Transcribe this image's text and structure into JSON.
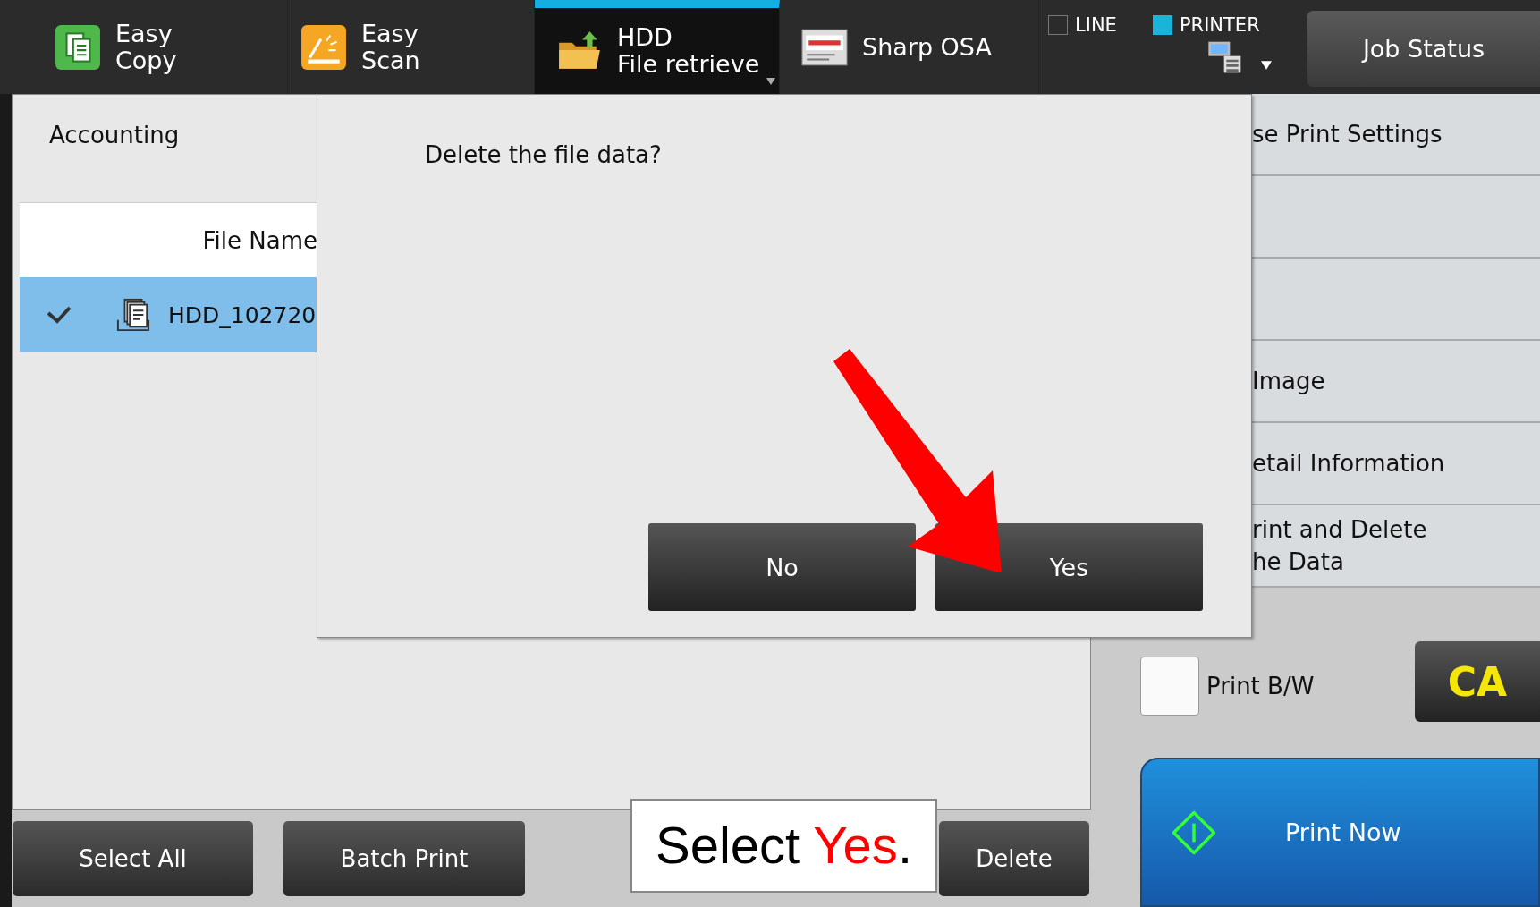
{
  "tabs": [
    {
      "kind": "copy",
      "lines": [
        "Easy",
        "Copy"
      ],
      "selected": false
    },
    {
      "kind": "scan",
      "lines": [
        "Easy",
        "Scan"
      ],
      "selected": false
    },
    {
      "kind": "folder",
      "lines": [
        "HDD",
        "File retrieve"
      ],
      "selected": true
    },
    {
      "kind": "osa",
      "lines": [
        "Sharp OSA"
      ],
      "selected": false
    }
  ],
  "modes": [
    {
      "label": "LINE",
      "checked": false
    },
    {
      "label": "PRINTER",
      "checked": true
    }
  ],
  "job_status": "Job Status",
  "panel": {
    "title": "Accounting",
    "column_header": "File Name",
    "rows": [
      {
        "name": "HDD_102720",
        "checked": true,
        "selected": true
      }
    ]
  },
  "actions": [
    {
      "kind": "text",
      "lines": [
        "se Print Settings"
      ]
    },
    {
      "kind": "blank"
    },
    {
      "kind": "blank"
    },
    {
      "kind": "text",
      "lines": [
        "Image"
      ]
    },
    {
      "kind": "text",
      "lines": [
        "etail Information"
      ]
    },
    {
      "kind": "text",
      "lines": [
        "rint and Delete",
        "he Data"
      ]
    }
  ],
  "print_bw": {
    "label": "Print B/W",
    "checked": false
  },
  "clear_all": "CA",
  "print_now": "Print Now",
  "bottom_buttons": [
    "Select All",
    "Batch Print",
    "Delete"
  ],
  "dialog": {
    "message": "Delete the file data?",
    "buttons": [
      "No",
      "Yes"
    ]
  },
  "callout": {
    "before": "Select ",
    "highlight": "Yes",
    "after": "."
  }
}
